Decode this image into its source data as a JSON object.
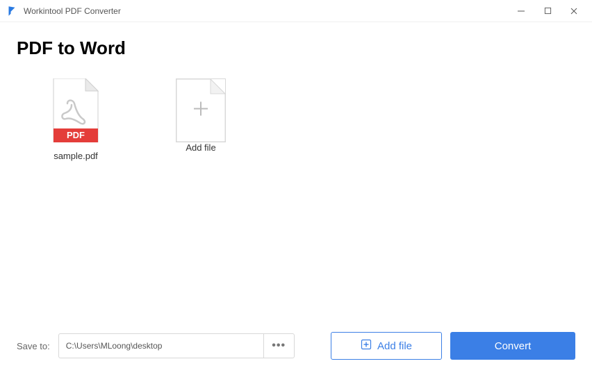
{
  "titlebar": {
    "app_name": "Workintool PDF Converter"
  },
  "page": {
    "title": "PDF to Word"
  },
  "files": {
    "items": [
      {
        "name": "sample.pdf",
        "badge": "PDF"
      }
    ],
    "add_tile_label": "Add file"
  },
  "bottom": {
    "save_to_label": "Save to:",
    "path_value": "C:\\Users\\MLoong\\desktop",
    "browse_label": "•••",
    "add_file_label": "Add file",
    "convert_label": "Convert"
  },
  "colors": {
    "accent": "#3b7fe6",
    "pdf_red": "#e43d3a"
  }
}
